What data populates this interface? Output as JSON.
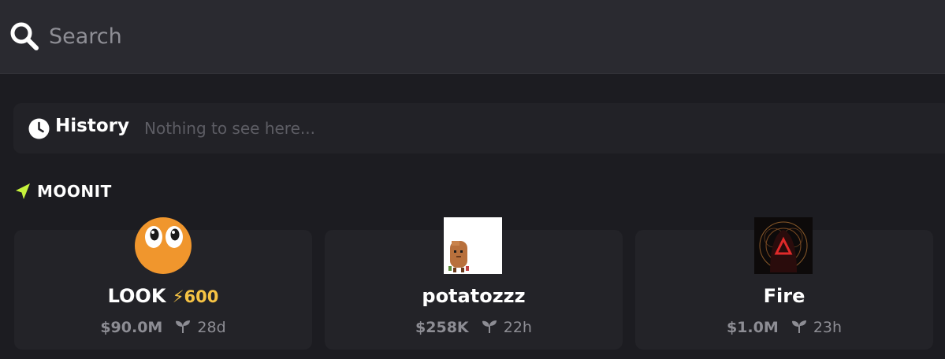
{
  "search": {
    "placeholder": "Search"
  },
  "history": {
    "label": "History",
    "empty_text": "Nothing to see here..."
  },
  "section": {
    "label": "MOONIT",
    "accent_color": "#c6f23c"
  },
  "cards": [
    {
      "name": "LOOK",
      "boost": "600",
      "market_cap": "$90.0M",
      "age": "28d",
      "image": "eyes-emoji"
    },
    {
      "name": "potatozzz",
      "boost": "",
      "market_cap": "$258K",
      "age": "22h",
      "image": "pixel-potato"
    },
    {
      "name": "Fire",
      "boost": "",
      "market_cap": "$1.0M",
      "age": "23h",
      "image": "red-triangle-hood"
    }
  ],
  "colors": {
    "boost": "#f6c344",
    "meta": "#8d8d94",
    "card_bg": "#232328"
  }
}
